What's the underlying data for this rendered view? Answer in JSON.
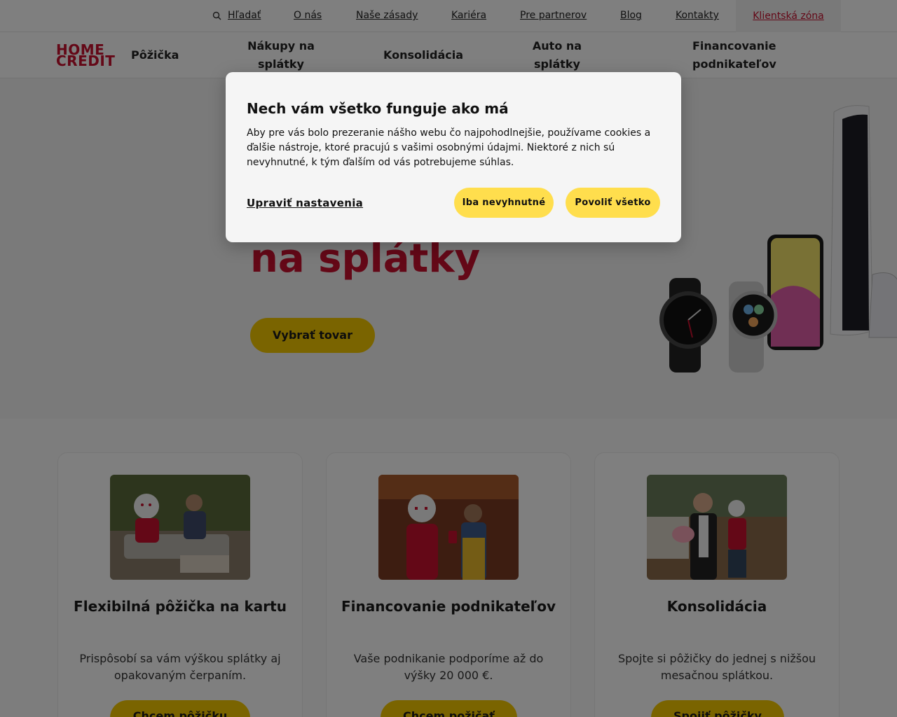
{
  "topbar": {
    "search": "Hľadať",
    "about": "O nás",
    "principles": "Naše zásady",
    "career": "Kariéra",
    "partners": "Pre partnerov",
    "blog": "Blog",
    "contacts": "Kontakty",
    "client_zone": "Klientská zóna"
  },
  "logo": {
    "line1": "HOME",
    "line2": "CREDIT"
  },
  "nav": {
    "loan": "Pôžička",
    "installments_1": "Nákupy na",
    "installments_2": "splátky",
    "consolidation": "Konsolidácia",
    "car_1": "Auto na",
    "car_2": "splátky",
    "business_1": "Financovanie",
    "business_2": "podnikateľov"
  },
  "hero": {
    "title": "na splátky",
    "button": "Vybrať tovar"
  },
  "cards": [
    {
      "title": "Flexibilná pôžička na kartu",
      "desc": "Prispôsobí sa vám výškou splátky aj opakovaným čerpaním.",
      "button": "Chcem pôžičku"
    },
    {
      "title": "Financovanie podnikateľov",
      "desc": "Vaše podnikanie podporíme až do výšky 20 000 €.",
      "button": "Chcem požičať"
    },
    {
      "title": "Konsolidácia",
      "desc": "Spojte si pôžičky do jednej s nižšou mesačnou splátkou.",
      "button": "Spojiť pôžičky"
    }
  ],
  "cookie": {
    "title": "Nech vám všetko funguje ako má",
    "text": "Aby pre vás bolo prezeranie nášho webu čo najpohodlnejšie, používame cookies a ďalšie nástroje, ktoré pracujú s vašimi osobnými údajmi. Niektoré z nich sú nevyhnutné, k tým ďalším od vás potrebujeme súhlas.",
    "settings": "Upraviť nastavenia",
    "necessary": "Iba nevyhnutné",
    "allow_all": "Povoliť všetko"
  },
  "colors": {
    "brand_red": "#c8102e",
    "accent_yellow": "#f5c800",
    "cookie_button": "#ffde4d"
  }
}
